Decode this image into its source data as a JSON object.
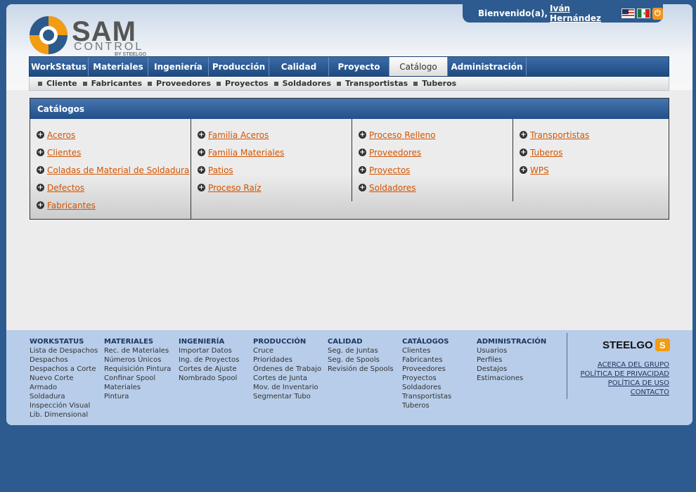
{
  "header": {
    "welcome_text": "Bienvenido(a),",
    "user_name": "Iván Hernández",
    "icons": [
      "flag-us-icon",
      "flag-mx-icon",
      "power-icon"
    ]
  },
  "logo": {
    "name": "SAM",
    "sub": "CONTROL",
    "by": "BY STEELGO"
  },
  "nav": {
    "tabs": [
      {
        "label": "WorkStatus"
      },
      {
        "label": "Materiales"
      },
      {
        "label": "Ingeniería"
      },
      {
        "label": "Producción"
      },
      {
        "label": "Calidad"
      },
      {
        "label": "Proyecto"
      },
      {
        "label": "Catálogo"
      },
      {
        "label": "Administración"
      }
    ],
    "active_tab": "Catálogo"
  },
  "subnav": {
    "items": [
      "Cliente",
      "Fabricantes",
      "Proveedores",
      "Proyectos",
      "Soldadores",
      "Transportistas",
      "Tuberos"
    ]
  },
  "catalogs": {
    "title": "Catálogos",
    "columns": [
      [
        "Aceros",
        "Clientes",
        "Coladas de Material de Soldadura",
        "Defectos",
        "Fabricantes"
      ],
      [
        "Familia Aceros",
        "Familia Materiales",
        "Patios",
        "Proceso Raíz"
      ],
      [
        "Proceso Relleno",
        "Proveedores",
        "Proyectos",
        "Soldadores"
      ],
      [
        "Transportistas",
        "Tuberos",
        "WPS"
      ]
    ]
  },
  "footer": {
    "columns": [
      {
        "title": "WORKSTATUS",
        "links": [
          "Lista de Despachos",
          "Despachos",
          "Despachos a Corte",
          "Nuevo Corte",
          "Armado",
          "Soldadura",
          "Inspección Visual",
          "Lib. Dimensional"
        ]
      },
      {
        "title": "MATERIALES",
        "links": [
          "Rec. de Materiales",
          "Números Únicos",
          "Requisición Pintura",
          "Confinar Spool",
          "Materiales",
          "Pintura"
        ]
      },
      {
        "title": "INGENIERÍA",
        "links": [
          "Importar Datos",
          "Ing. de Proyectos",
          "Cortes de Ajuste",
          "Nombrado Spool"
        ]
      },
      {
        "title": "PRODUCCIÓN",
        "links": [
          "Cruce",
          "Prioridades",
          "Órdenes de Trabajo",
          "Cortes de Junta",
          "Mov. de Inventario",
          "Segmentar Tubo"
        ]
      },
      {
        "title": "CALIDAD",
        "links": [
          "Seg. de Juntas",
          "Seg. de Spools",
          "Revisión de Spools"
        ]
      },
      {
        "title": "CATÁLOGOS",
        "links": [
          "Clientes",
          "Fabricantes",
          "Proveedores",
          "Proyectos",
          "Soldadores",
          "Transportistas",
          "Tuberos"
        ]
      },
      {
        "title": "ADMINISTRACIÓN",
        "links": [
          "Usuarios",
          "Perfiles",
          "Destajos",
          "Estimaciones"
        ]
      }
    ],
    "brand": "STEELGO",
    "links": [
      "ACERCA DEL GRUPO",
      "POLÍTICA DE PRIVACIDAD",
      "POLÍTICA DE USO",
      "CONTACTO"
    ]
  }
}
